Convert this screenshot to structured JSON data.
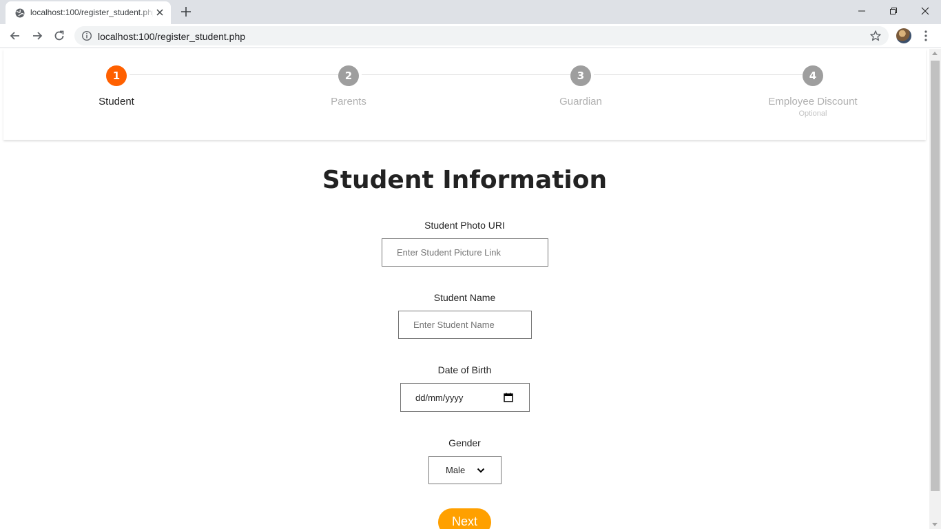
{
  "browser": {
    "tab_title": "localhost:100/register_student.php",
    "url": "localhost:100/register_student.php"
  },
  "stepper": {
    "steps": [
      {
        "number": "1",
        "label": "Student",
        "state": "active"
      },
      {
        "number": "2",
        "label": "Parents",
        "state": "idle"
      },
      {
        "number": "3",
        "label": "Guardian",
        "state": "idle"
      },
      {
        "number": "4",
        "label": "Employee Discount",
        "sublabel": "Optional",
        "state": "idle"
      }
    ]
  },
  "form": {
    "title": "Student Information",
    "photo": {
      "label": "Student Photo URI",
      "placeholder": "Enter Student Picture Link"
    },
    "name": {
      "label": "Student Name",
      "placeholder": "Enter Student Name"
    },
    "dob": {
      "label": "Date of Birth",
      "value": "dd/mm/yyyy"
    },
    "gender": {
      "label": "Gender",
      "value": "Male"
    },
    "next_label": "Next"
  },
  "colors": {
    "active_step": "#ff6000",
    "idle_step": "#9e9e9e",
    "next_button": "#ffa000"
  }
}
